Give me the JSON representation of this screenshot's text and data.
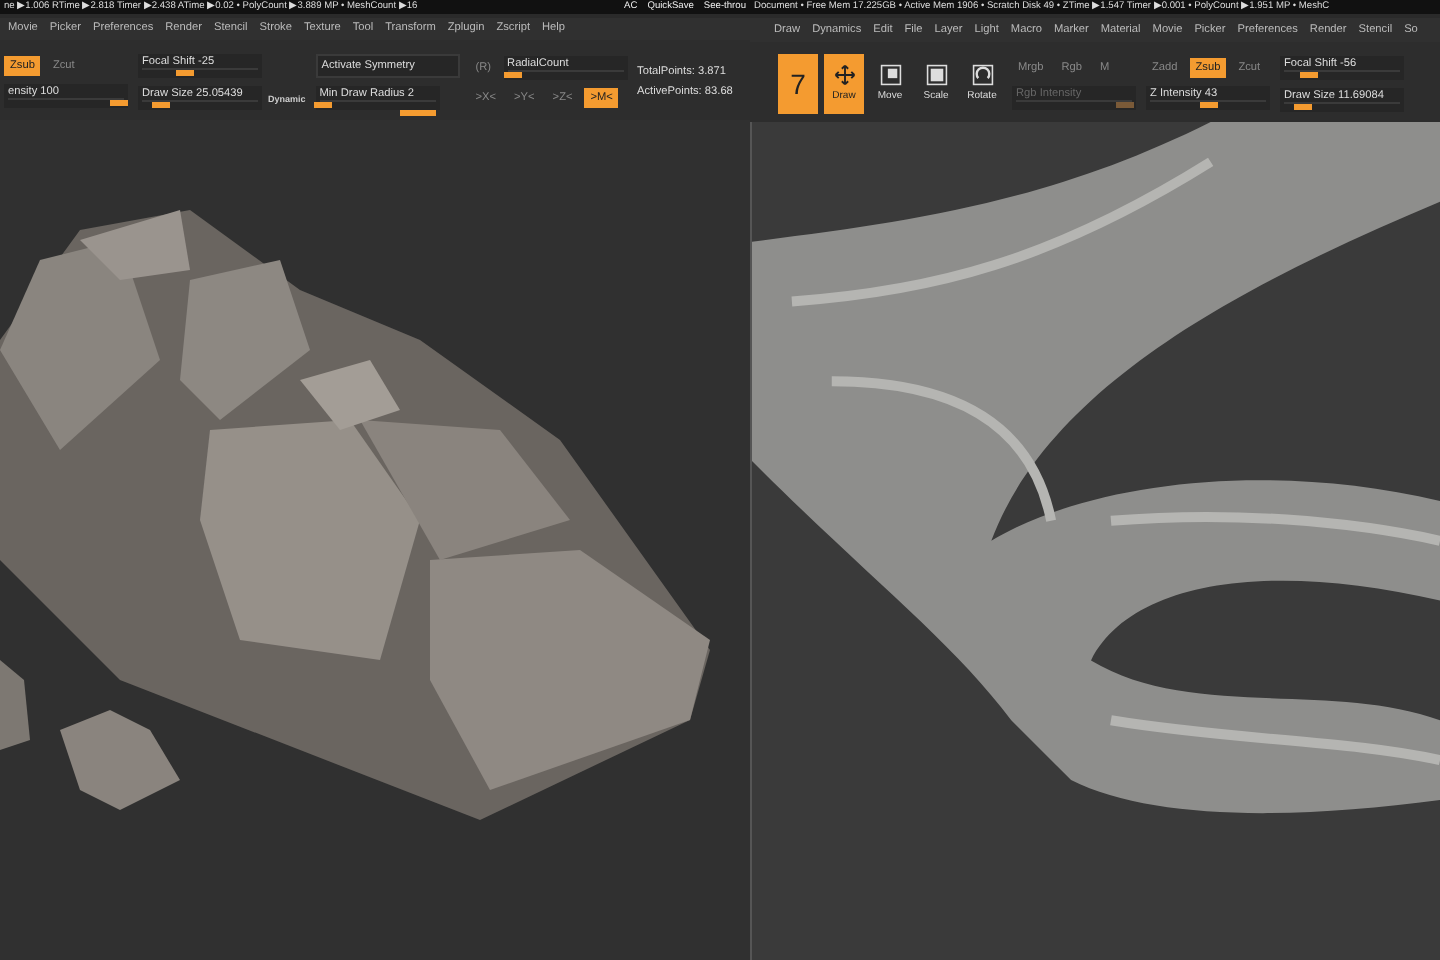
{
  "windows": [
    {
      "status": {
        "text": "ne ▶1.006 RTime ▶2.818 Timer ▶2.438 ATime ▶0.02 • PolyCount ▶3.889 MP • MeshCount ▶16",
        "right": [
          "AC",
          "QuickSave",
          "See-throu"
        ]
      },
      "menu": [
        "Movie",
        "Picker",
        "Preferences",
        "Render",
        "Stencil",
        "Stroke",
        "Texture",
        "Tool",
        "Transform",
        "Zplugin",
        "Zscript",
        "Help"
      ],
      "toolbar": [
        [
          [
            {
              "kind": "button",
              "label": "Zsub",
              "selected": true
            },
            {
              "kind": "button",
              "label": "Zcut",
              "selected": false
            }
          ],
          [
            {
              "kind": "slider",
              "label": "ensity 100",
              "level": 0.95
            }
          ]
        ],
        [
          [
            {
              "kind": "slider",
              "label": "Focal Shift -25",
              "level": 0.37
            }
          ],
          [
            {
              "kind": "slider",
              "label": "Draw Size 25.05439",
              "level": 0.15
            },
            {
              "kind": "tag",
              "label": "Dynamic"
            }
          ]
        ],
        [
          [
            {
              "kind": "field",
              "label": "Activate Symmetry"
            }
          ],
          [
            {
              "kind": "slider",
              "label": "Min Draw Radius 2",
              "level": 0.02
            }
          ]
        ],
        [
          [
            {
              "kind": "button",
              "label": "(R)",
              "selected": false
            },
            {
              "kind": "slider",
              "label": "RadialCount",
              "level": 0.05
            }
          ],
          [
            {
              "kind": "button",
              "label": ">X<",
              "selected": false
            },
            {
              "kind": "button",
              "label": ">Y<",
              "selected": false
            },
            {
              "kind": "button",
              "label": ">Z<",
              "selected": false
            },
            {
              "kind": "button",
              "label": ">M<",
              "selected": true
            }
          ]
        ],
        [
          [
            {
              "kind": "text",
              "label": "TotalPoints: 3.871"
            }
          ],
          [
            {
              "kind": "text",
              "label": "ActivePoints: 83.68"
            }
          ]
        ]
      ],
      "viewport": {
        "kind": "rocks"
      }
    },
    {
      "status": {
        "text": "Document • Free Mem 17.225GB • Active Mem 1906 • Scratch Disk 49 • ZTime ▶1.547 Timer ▶0.001 • PolyCount ▶1.951 MP • MeshC"
      },
      "menu": [
        "Draw",
        "Dynamics",
        "Edit",
        "File",
        "Layer",
        "Light",
        "Macro",
        "Marker",
        "Material",
        "Movie",
        "Picker",
        "Preferences",
        "Render",
        "Stencil",
        "So"
      ],
      "toolbar": [
        [
          [
            {
              "kind": "tool",
              "label": "7",
              "selected": true
            },
            {
              "kind": "tool",
              "label": "Draw",
              "selected": true
            },
            {
              "kind": "tool",
              "label": "Move",
              "selected": false
            },
            {
              "kind": "tool",
              "label": "Scale",
              "selected": false
            },
            {
              "kind": "tool",
              "label": "Rotate",
              "selected": false
            }
          ]
        ],
        [
          [
            {
              "kind": "button",
              "label": "Mrgb",
              "selected": false
            },
            {
              "kind": "button",
              "label": "Rgb",
              "selected": false
            },
            {
              "kind": "button",
              "label": "M",
              "selected": false
            }
          ],
          [
            {
              "kind": "slider",
              "label": "Rgb Intensity",
              "level": 0.93,
              "disabled": true
            }
          ]
        ],
        [
          [
            {
              "kind": "button",
              "label": "Zadd",
              "selected": false
            },
            {
              "kind": "button",
              "label": "Zsub",
              "selected": true
            },
            {
              "kind": "button",
              "label": "Zcut",
              "selected": false
            }
          ],
          [
            {
              "kind": "slider",
              "label": "Z Intensity 43",
              "level": 0.5
            }
          ]
        ],
        [
          [
            {
              "kind": "slider",
              "label": "Focal Shift -56",
              "level": 0.2
            }
          ],
          [
            {
              "kind": "slider",
              "label": "Draw Size 11.69084",
              "level": 0.15
            }
          ]
        ]
      ],
      "viewport": {
        "kind": "branch"
      }
    }
  ]
}
